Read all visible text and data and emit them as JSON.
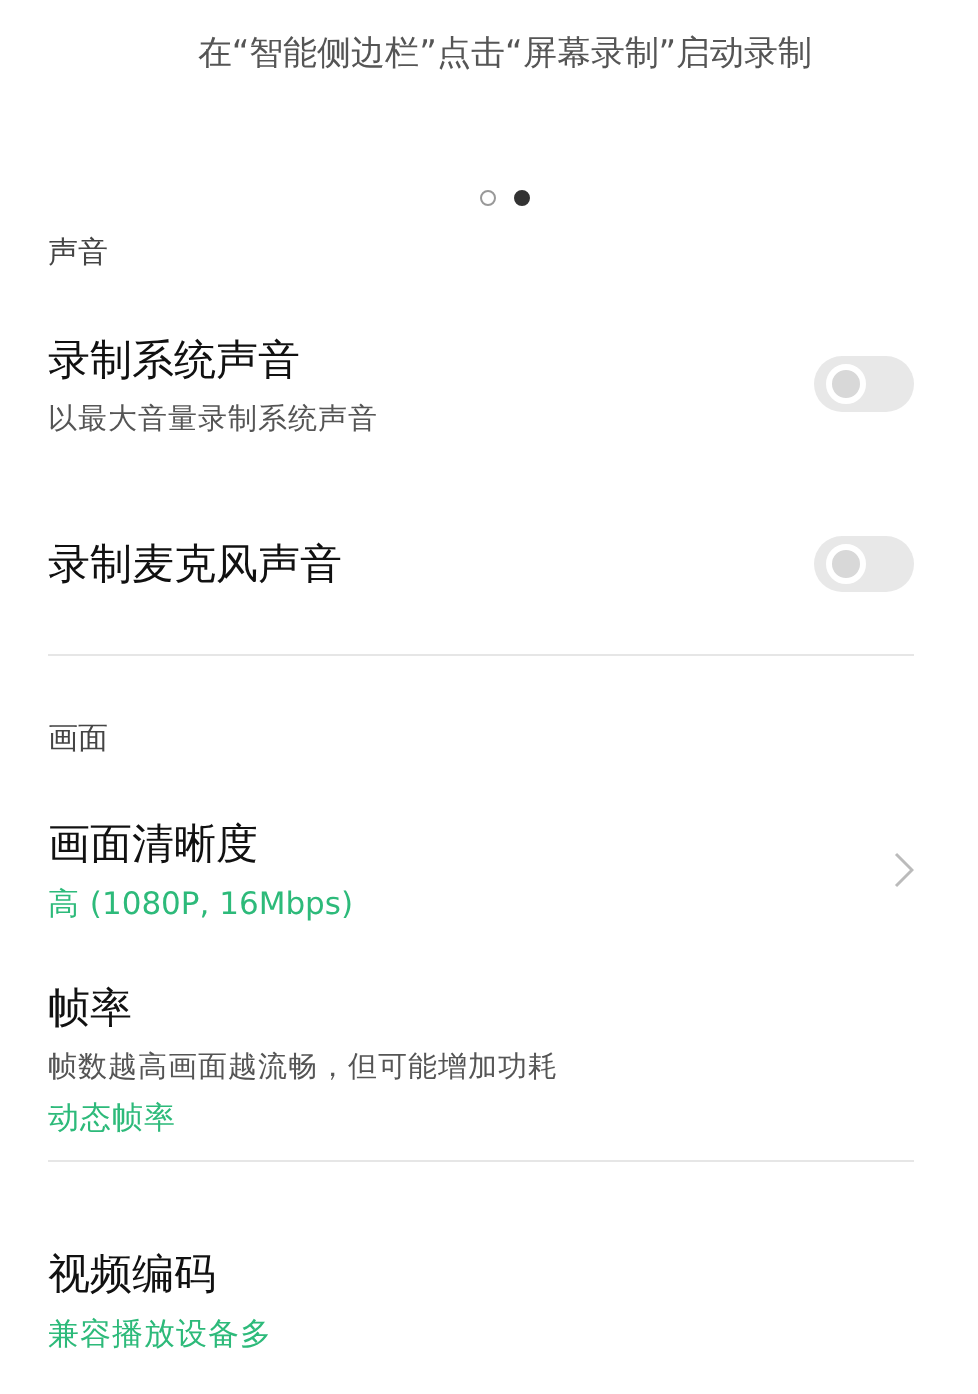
{
  "hint": "在“智能侧边栏”点击“屏幕录制”启动录制",
  "pager": [
    {
      "selected": false
    },
    {
      "selected": true
    }
  ],
  "sections": [
    {
      "title": "声音",
      "items": [
        {
          "kind": "toggle",
          "title": "录制系统声音",
          "subtitle": "以最大音量录制系统声音",
          "on": false
        },
        {
          "kind": "toggle",
          "title": "录制麦克风声音",
          "on": false
        }
      ]
    },
    {
      "title": "画面",
      "items": [
        {
          "kind": "link",
          "title": "画面清晰度",
          "value": "高 (1080P, 16Mbps)"
        },
        {
          "kind": "plain",
          "title": "帧率",
          "subtitle": "帧数越高画面越流畅，但可能增加功耗",
          "value": "动态帧率"
        }
      ]
    },
    {
      "items": [
        {
          "kind": "plain",
          "title": "视频编码",
          "value": "兼容播放设备多"
        }
      ]
    }
  ]
}
